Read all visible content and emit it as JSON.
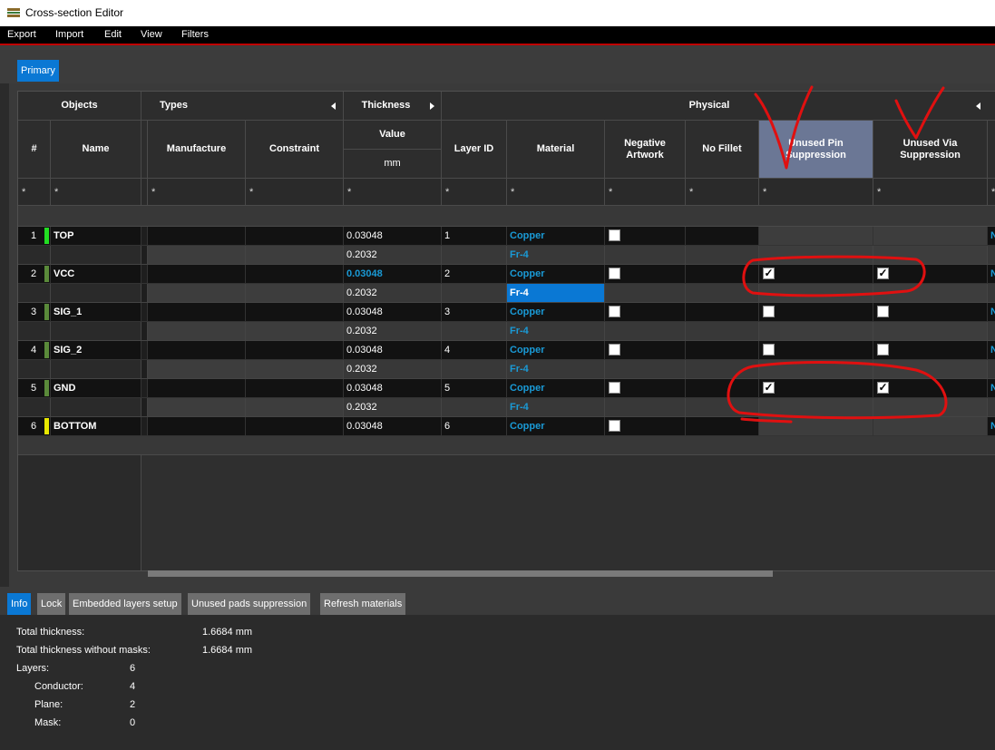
{
  "window": {
    "title": "Cross-section Editor"
  },
  "menu": [
    "Export",
    "Import",
    "Edit",
    "View",
    "Filters"
  ],
  "tabs": {
    "primary": "Primary"
  },
  "headers": {
    "objects": "Objects",
    "types": "Types",
    "thickness": "Thickness",
    "physical": "Physical",
    "num": "#",
    "name": "Name",
    "manufacture": "Manufacture",
    "constraint": "Constraint",
    "value": "Value",
    "unit": "mm",
    "layer_id": "Layer ID",
    "material": "Material",
    "negative_artwork": "Negative Artwork",
    "no_fillet": "No Fillet",
    "unused_pin": "Unused Pin Suppression",
    "unused_via": "Unused Via Suppression",
    "filter": "*"
  },
  "rows": [
    {
      "num": "1",
      "name": "TOP",
      "swatch": "#22dd22",
      "thickness": "0.03048",
      "layer_id": "1",
      "material": "Copper",
      "neg": false,
      "pin": null,
      "via": null,
      "trailing": "N"
    },
    {
      "thickness": "0.2032",
      "material": "Fr-4"
    },
    {
      "num": "2",
      "name": "VCC",
      "swatch": "#5a8a3a",
      "thickness": "0.03048",
      "thickness_highlight": true,
      "layer_id": "2",
      "material": "Copper",
      "neg": false,
      "pin": true,
      "via": true,
      "trailing": "N"
    },
    {
      "thickness": "0.2032",
      "material": "Fr-4",
      "material_selected": true
    },
    {
      "num": "3",
      "name": "SIG_1",
      "swatch": "#5a8a3a",
      "thickness": "0.03048",
      "layer_id": "3",
      "material": "Copper",
      "neg": false,
      "pin": false,
      "via": false,
      "trailing": "N"
    },
    {
      "thickness": "0.2032",
      "material": "Fr-4"
    },
    {
      "num": "4",
      "name": "SIG_2",
      "swatch": "#5a8a3a",
      "thickness": "0.03048",
      "layer_id": "4",
      "material": "Copper",
      "neg": false,
      "pin": false,
      "via": false,
      "trailing": "N"
    },
    {
      "thickness": "0.2032",
      "material": "Fr-4"
    },
    {
      "num": "5",
      "name": "GND",
      "swatch": "#5a8a3a",
      "thickness": "0.03048",
      "layer_id": "5",
      "material": "Copper",
      "neg": false,
      "pin": true,
      "via": true,
      "trailing": "N"
    },
    {
      "thickness": "0.2032",
      "material": "Fr-4"
    },
    {
      "num": "6",
      "name": "BOTTOM",
      "swatch": "#e8e800",
      "thickness": "0.03048",
      "layer_id": "6",
      "material": "Copper",
      "neg": false,
      "pin": null,
      "via": null,
      "trailing": "N"
    }
  ],
  "bottom_tabs": [
    "Info",
    "Lock",
    "Embedded layers setup",
    "Unused pads suppression",
    "Refresh materials"
  ],
  "info": {
    "total_thickness_label": "Total thickness:",
    "total_thickness_value": "1.6684 mm",
    "total_wo_masks_label": "Total thickness without masks:",
    "total_wo_masks_value": "1.6684 mm",
    "layers_label": "Layers:",
    "layers_value": "6",
    "conductor_label": "Conductor:",
    "conductor_value": "4",
    "plane_label": "Plane:",
    "plane_value": "2",
    "mask_label": "Mask:",
    "mask_value": "0"
  },
  "colors": {
    "accent": "#0a78d4",
    "material": "#1a9ad6",
    "annotation": "#e01010",
    "selected_header": "#6b7795"
  }
}
